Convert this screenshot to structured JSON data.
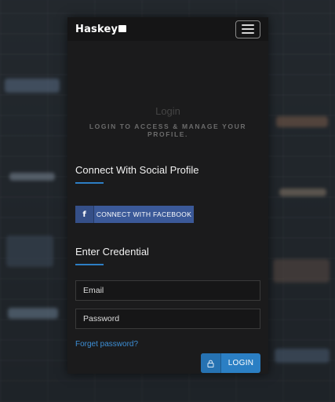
{
  "brand": {
    "logo_text": "Haskey"
  },
  "nav": {
    "menu_icon": "hamburger-icon"
  },
  "hero": {
    "title": "Login",
    "subtitle": "LOGIN TO ACCESS & MANAGE YOUR PROFILE."
  },
  "social": {
    "heading": "Connect With Social Profile",
    "facebook_label": "CONNECT WITH FACEBOOK",
    "facebook_icon": "f"
  },
  "credentials": {
    "heading": "Enter Credential",
    "email_placeholder": "Email",
    "password_placeholder": "Password",
    "forgot_label": "Forget password?",
    "login_label": "LOGIN"
  },
  "colors": {
    "accent": "#2b7fc4",
    "facebook": "#3b5998",
    "panel": "#1b1b1c"
  }
}
